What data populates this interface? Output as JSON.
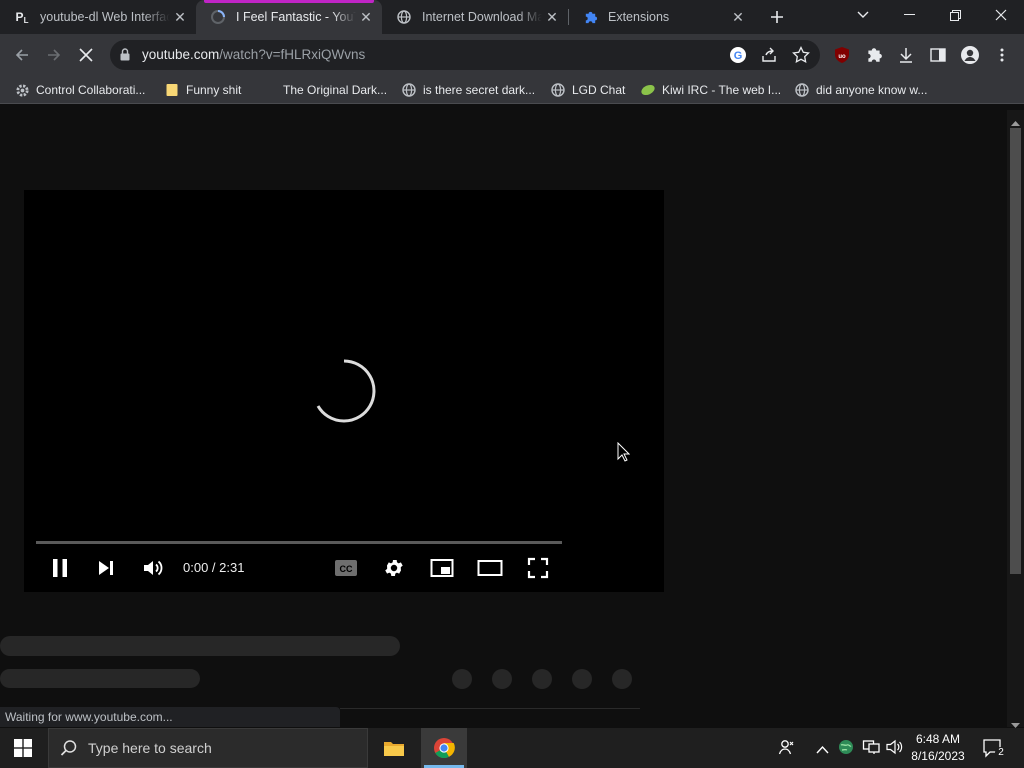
{
  "browser": {
    "tabs": [
      {
        "title": "youtube-dl Web Interface",
        "favicon": "pl-letter-icon",
        "active": false
      },
      {
        "title": "I Feel Fantastic - YouTube",
        "favicon": "loading-spinner-icon",
        "active": true
      },
      {
        "title": "Internet Download Manager",
        "favicon": "globe-icon",
        "active": false
      },
      {
        "title": "Extensions",
        "favicon": "puzzle-icon",
        "active": false
      }
    ],
    "url": {
      "host": "youtube.com",
      "path": "/watch?v=fHLRxiQWvns"
    },
    "bookmarks": [
      {
        "label": "Control Collaborati...",
        "icon": "gear-cog-icon"
      },
      {
        "label": "Funny shit",
        "icon": "folder-icon"
      },
      {
        "label": "The Original Dark...",
        "icon": ""
      },
      {
        "label": "is there secret dark...",
        "icon": "globe-icon"
      },
      {
        "label": "LGD Chat",
        "icon": "globe-icon"
      },
      {
        "label": "Kiwi IRC - The web I...",
        "icon": "kiwi-icon"
      },
      {
        "label": "did anyone know w...",
        "icon": "globe-icon"
      }
    ],
    "status": "Waiting for www.youtube.com..."
  },
  "player": {
    "time": "0:00 / 2:31",
    "state": "loading"
  },
  "taskbar": {
    "search_placeholder": "Type here to search",
    "time": "6:48 AM",
    "date": "8/16/2023",
    "notifications": "2"
  },
  "colors": {
    "accent_tab": "#c025c6",
    "page_bg": "#0f0f0f"
  }
}
